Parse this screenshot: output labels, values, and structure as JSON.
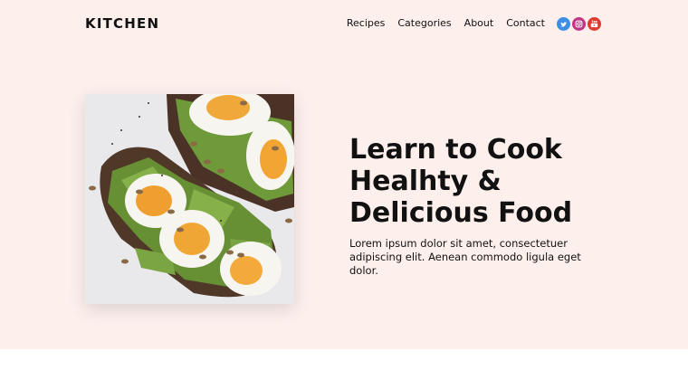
{
  "brand": {
    "logo": "KITCHEN"
  },
  "nav": {
    "items": [
      {
        "label": "Recipes"
      },
      {
        "label": "Categories"
      },
      {
        "label": "About"
      },
      {
        "label": "Contact"
      }
    ]
  },
  "socials": [
    {
      "icon": "twitter-icon",
      "color": "#3d8ee6"
    },
    {
      "icon": "instagram-icon",
      "color": "#c13584"
    },
    {
      "icon": "youtube-icon",
      "color": "#e03a2f"
    }
  ],
  "hero": {
    "image_icon": "avocado-egg-toast-photo",
    "headline": "Learn to Cook Healhty & Delicious Food",
    "text": "Lorem ipsum dolor sit amet, consectetuer adipiscing elit. Aenean commodo ligula eget dolor."
  },
  "colors": {
    "background": "#fcefec",
    "text": "#111111"
  }
}
